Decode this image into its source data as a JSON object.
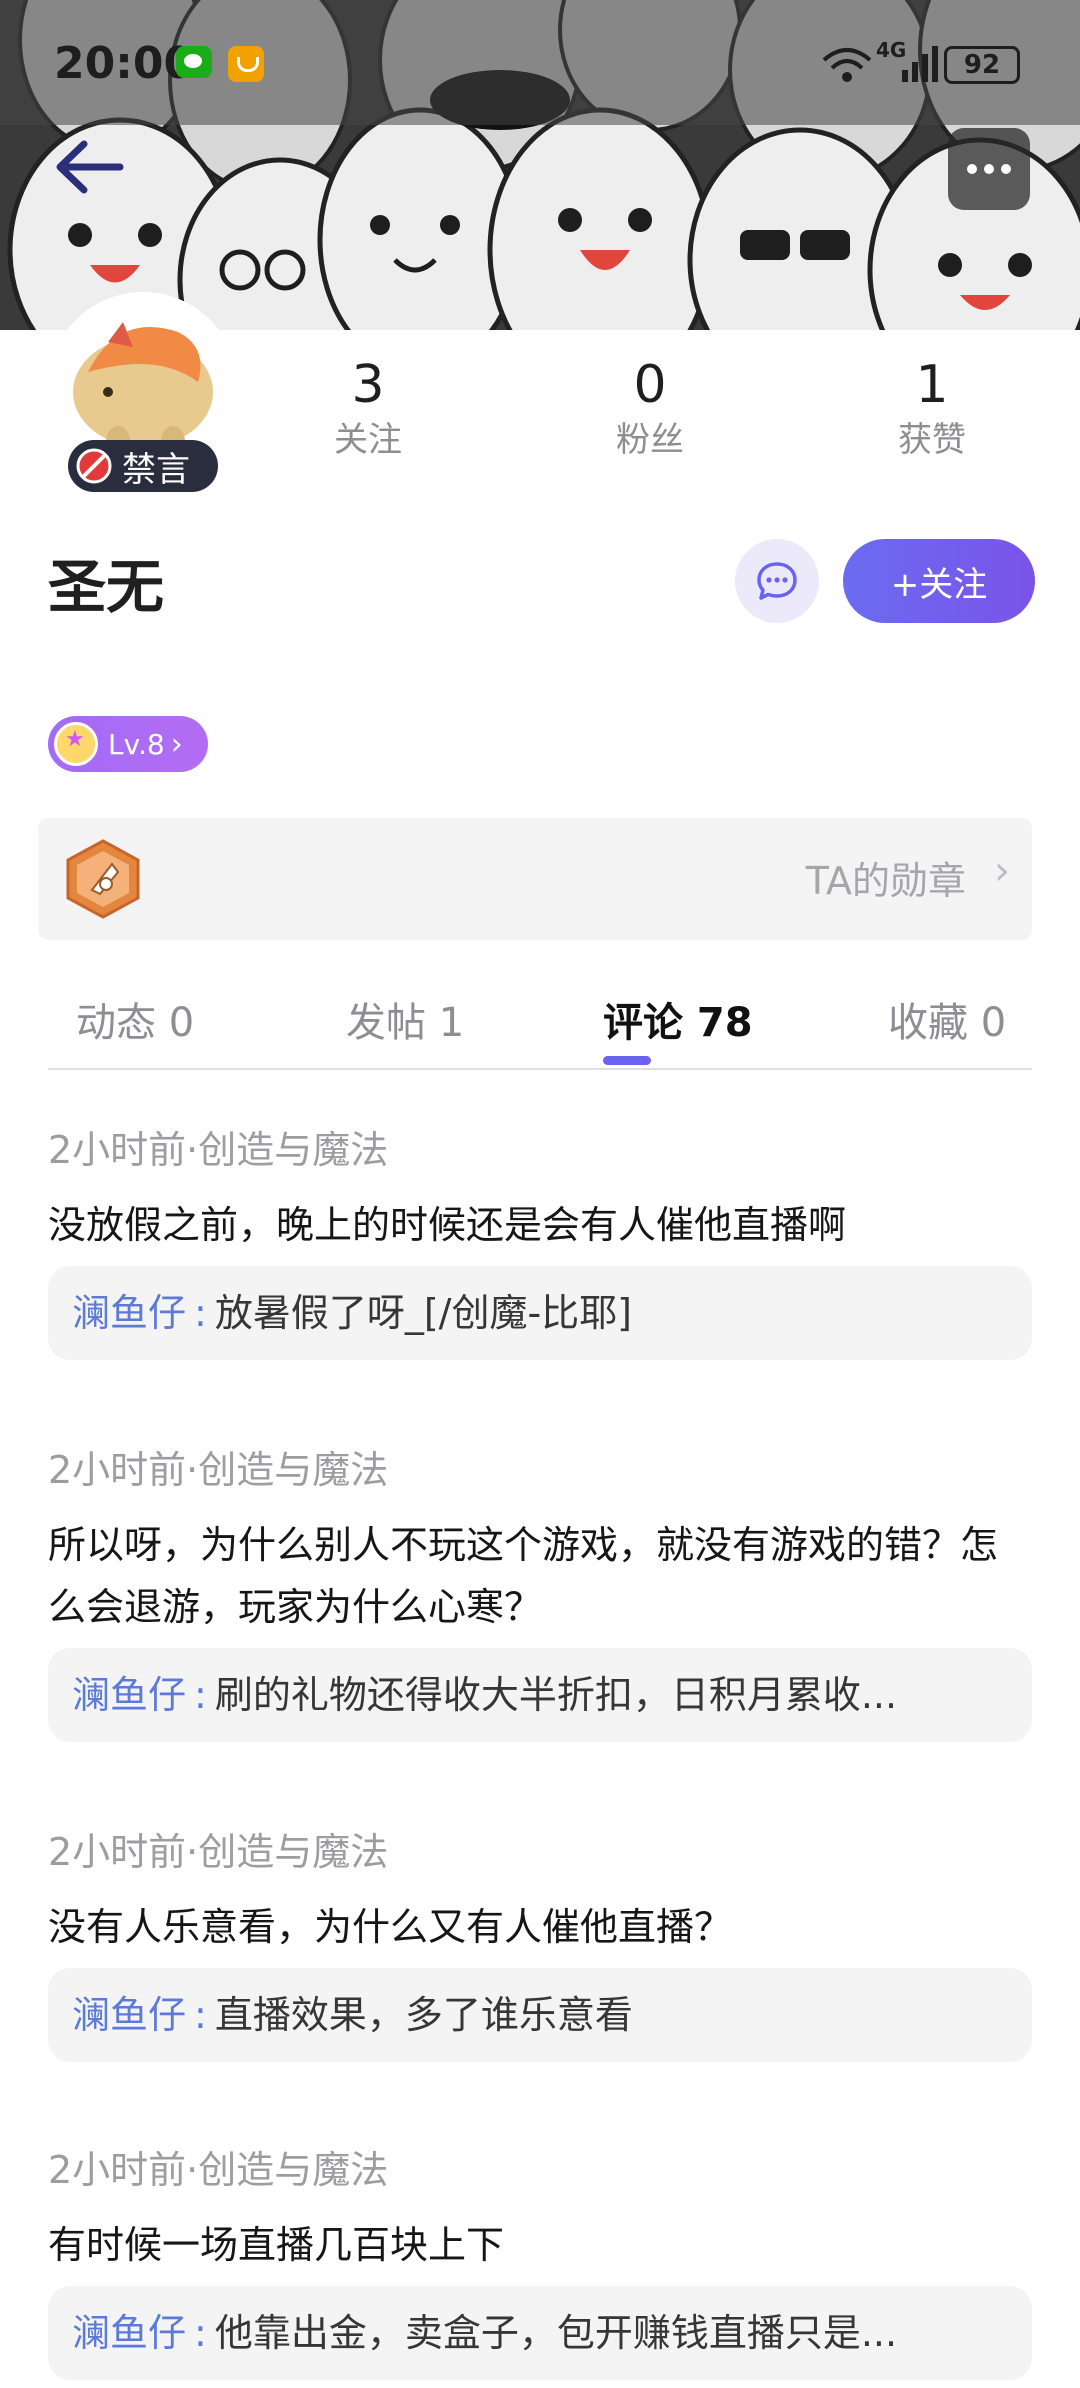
{
  "status_bar": {
    "time": "20:00",
    "network": "4G",
    "battery": "92"
  },
  "profile": {
    "name": "圣无",
    "mute_label": "禁言",
    "stats": [
      {
        "value": "3",
        "label": "关注"
      },
      {
        "value": "0",
        "label": "粉丝"
      },
      {
        "value": "1",
        "label": "获赞"
      }
    ],
    "follow_label": "+关注",
    "level_label": "Lv.8",
    "medal_label": "TA的勋章"
  },
  "tabs": [
    {
      "label": "动态 0",
      "active": false
    },
    {
      "label": "发帖 1",
      "active": false
    },
    {
      "label": "评论 78",
      "active": true
    },
    {
      "label": "收藏 0",
      "active": false
    }
  ],
  "comments": [
    {
      "meta": "2小时前·创造与魔法",
      "text": "没放假之前，晚上的时候还是会有人催他直播啊",
      "reply_user": "澜鱼仔",
      "reply_sep": ":",
      "reply_text": "放暑假了呀_[/创魔-比耶]"
    },
    {
      "meta": "2小时前·创造与魔法",
      "text": "所以呀，为什么别人不玩这个游戏，就没有游戏的错？怎么会退游，玩家为什么心寒？",
      "reply_user": "澜鱼仔",
      "reply_sep": ":",
      "reply_text": "刷的礼物还得收大半折扣，日积月累收..."
    },
    {
      "meta": "2小时前·创造与魔法",
      "text": "没有人乐意看，为什么又有人催他直播？",
      "reply_user": "澜鱼仔",
      "reply_sep": ":",
      "reply_text": "直播效果，多了谁乐意看"
    },
    {
      "meta": "2小时前·创造与魔法",
      "text": "有时候一场直播几百块上下",
      "reply_user": "澜鱼仔",
      "reply_sep": ":",
      "reply_text": "他靠出金，卖盒子，包开赚钱直播只是..."
    }
  ],
  "colors": {
    "accent": "#6a63ef",
    "reply_name": "#5c7ad6",
    "mute_badge": "#2a2d3e"
  },
  "icons": [
    "back-arrow-icon",
    "more-icon",
    "chat-bubble-icon",
    "ban-icon",
    "level-star-icon",
    "medal-icon",
    "chevron-right-icon"
  ]
}
